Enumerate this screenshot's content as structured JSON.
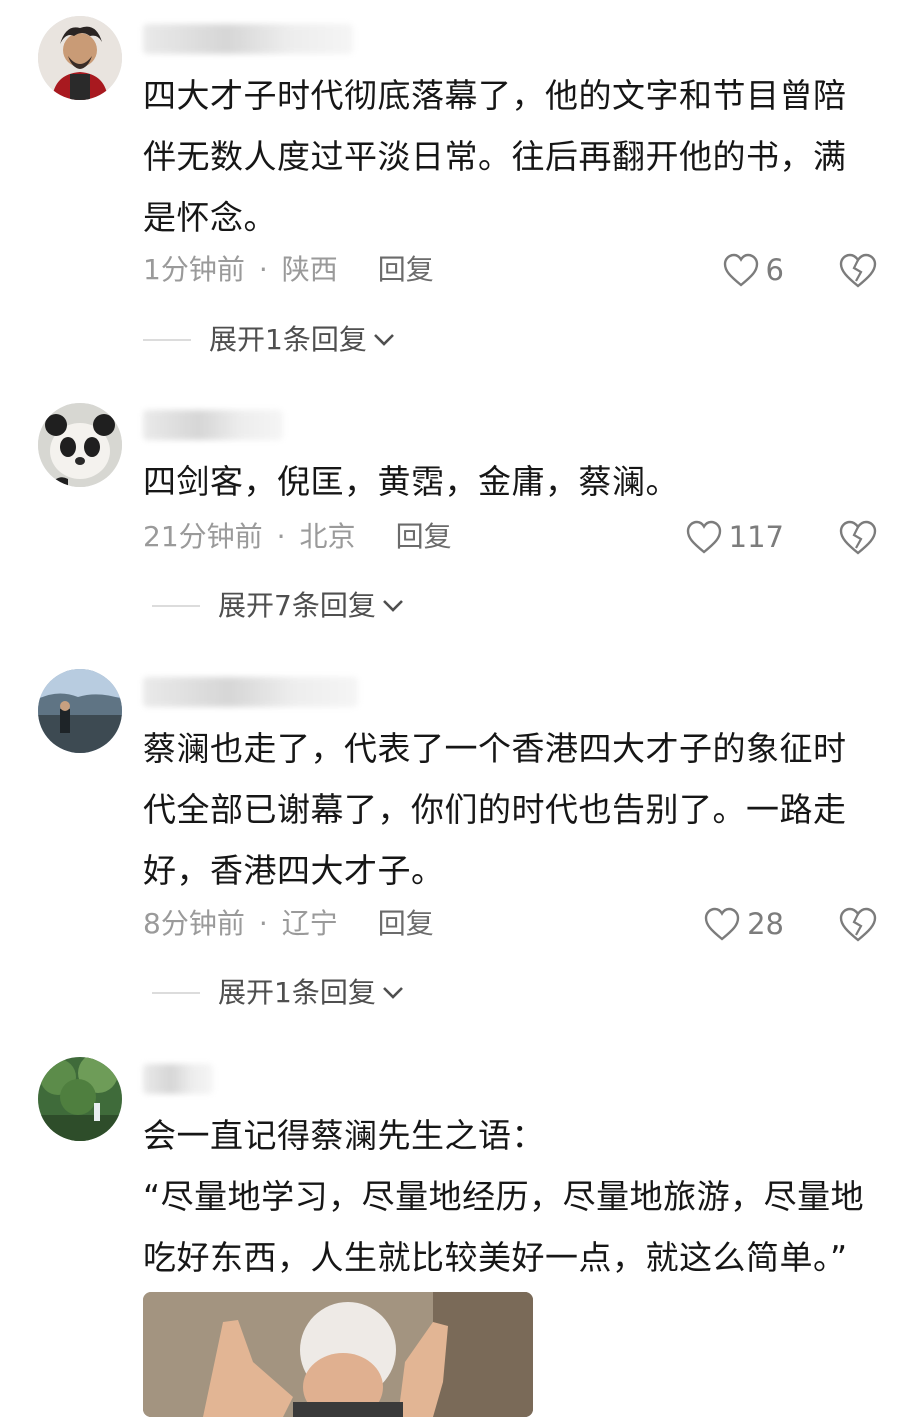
{
  "comments": [
    {
      "text_lines": [
        "四大才子时代彻底落幕了，他的文字和节目曾陪",
        "伴无数人度过平淡日常。往后再翻开他的书，满",
        "是怀念。"
      ],
      "time": "1分钟前",
      "dot": "·",
      "location": "陕西",
      "reply_label": "回复",
      "likes": "6",
      "expand_label": "展开1条回复"
    },
    {
      "text_lines": [
        "四剑客，倪匡，黄霑，金庸，蔡澜。"
      ],
      "time": "21分钟前",
      "dot": "·",
      "location": "北京",
      "reply_label": "回复",
      "likes": "117",
      "expand_label": "展开7条回复"
    },
    {
      "text_lines": [
        "蔡澜也走了，代表了一个香港四大才子的象征时",
        "代全部已谢幕了，你们的时代也告别了。一路走",
        "好，香港四大才子。"
      ],
      "time": "8分钟前",
      "dot": "·",
      "location": "辽宁",
      "reply_label": "回复",
      "likes": "28",
      "expand_label": "展开1条回复"
    },
    {
      "text_lines": [
        "会一直记得蔡澜先生之语：",
        "“尽量地学习，尽量地经历，尽量地旅游，尽量地",
        "吃好东西，人生就比较美好一点，就这么简单。”"
      ]
    }
  ],
  "colors": {
    "text": "#161616",
    "meta": "#9a9a9a",
    "reply": "#6b6b6b",
    "expand": "#4f4f4f",
    "icon": "#7c7c7c"
  },
  "icons": [
    "heart-outline-icon",
    "broken-heart-icon",
    "chevron-down-icon"
  ]
}
